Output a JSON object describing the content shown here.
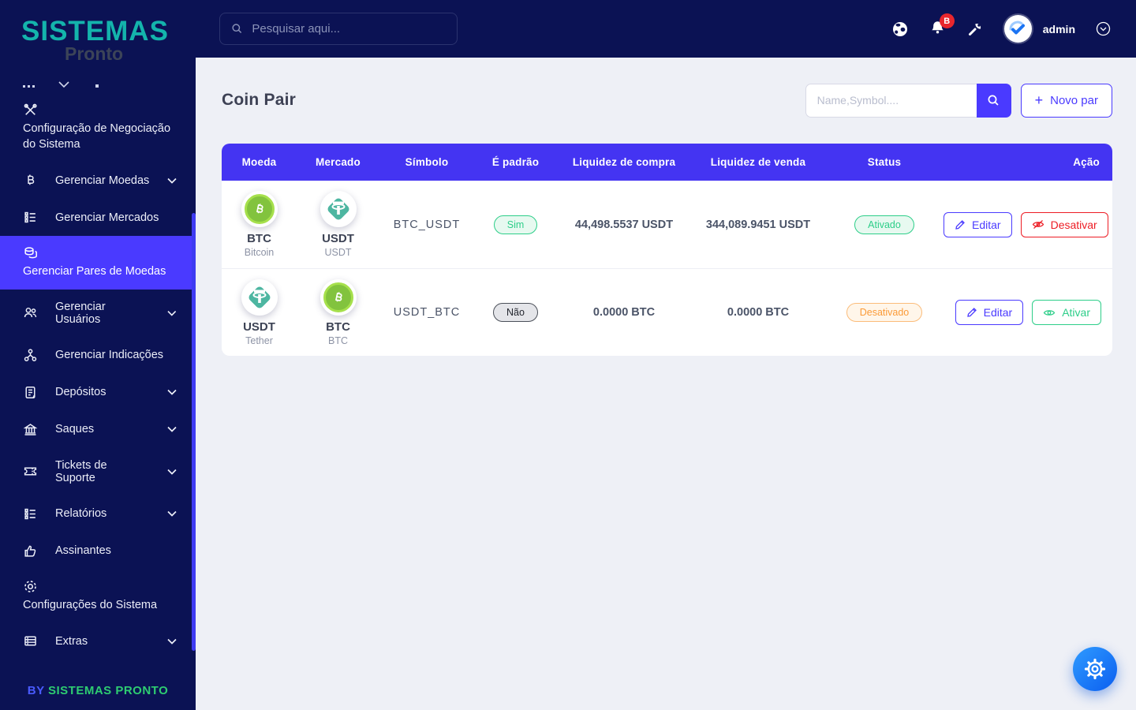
{
  "sidebar": {
    "logo_title": "SISTEMAS",
    "logo_subtitle": "Pronto",
    "items": [
      {
        "label": "Configuração de Negociação do Sistema",
        "icon": "tools-icon",
        "chevron": false
      },
      {
        "label": "Gerenciar Moedas",
        "icon": "bitcoin-icon",
        "chevron": true
      },
      {
        "label": "Gerenciar Mercados",
        "icon": "list-icon",
        "chevron": false
      },
      {
        "label": "Gerenciar Pares de Moedas",
        "icon": "coin-stack-icon",
        "chevron": false,
        "active": true
      },
      {
        "label": "Gerenciar Usuários",
        "icon": "users-icon",
        "chevron": true
      },
      {
        "label": "Gerenciar Indicações",
        "icon": "network-icon",
        "chevron": false
      },
      {
        "label": "Depósitos",
        "icon": "deposit-icon",
        "chevron": true
      },
      {
        "label": "Saques",
        "icon": "bank-icon",
        "chevron": true
      },
      {
        "label": "Tickets de Suporte",
        "icon": "ticket-icon",
        "chevron": true
      },
      {
        "label": "Relatórios",
        "icon": "report-icon",
        "chevron": true
      },
      {
        "label": "Assinantes",
        "icon": "thumbs-up-icon",
        "chevron": false
      },
      {
        "label": "Configurações do Sistema",
        "icon": "gear-icon",
        "chevron": false
      },
      {
        "label": "Extras",
        "icon": "extras-icon",
        "chevron": true
      }
    ],
    "footer_by": "BY",
    "footer_brand": "SISTEMAS PRONTO"
  },
  "topbar": {
    "search_placeholder": "Pesquisar aqui...",
    "notification_badge": "B",
    "username": "admin"
  },
  "page": {
    "title": "Coin Pair",
    "filter_placeholder": "Name,Symbol....",
    "new_pair_label": "Novo par"
  },
  "table": {
    "headers": [
      "Moeda",
      "Mercado",
      "Símbolo",
      "É padrão",
      "Liquidez de compra",
      "Liquidez de venda",
      "Status",
      "Ação"
    ],
    "rows": [
      {
        "coin": {
          "symbol": "BTC",
          "name": "Bitcoin",
          "icon": "bitcoin-coin-icon"
        },
        "market": {
          "symbol": "USDT",
          "name": "USDT",
          "icon": "tether-coin-icon"
        },
        "pair": "BTC_USDT",
        "is_default": "Sim",
        "buy_liquidity": "44,498.5537 USDT",
        "sell_liquidity": "344,089.9451 USDT",
        "status": "Ativado",
        "actions": [
          {
            "label": "Editar",
            "icon": "pencil-icon"
          },
          {
            "label": "Desativar",
            "icon": "eye-off-icon"
          }
        ]
      },
      {
        "coin": {
          "symbol": "USDT",
          "name": "Tether",
          "icon": "tether-coin-icon"
        },
        "market": {
          "symbol": "BTC",
          "name": "BTC",
          "icon": "bitcoin-coin-icon"
        },
        "pair": "USDT_BTC",
        "is_default": "Não",
        "buy_liquidity": "0.0000 BTC",
        "sell_liquidity": "0.0000 BTC",
        "status": "Desativado",
        "actions": [
          {
            "label": "Editar",
            "icon": "pencil-icon"
          },
          {
            "label": "Ativar",
            "icon": "eye-icon"
          }
        ]
      }
    ]
  },
  "colors": {
    "accent_purple": "#4a3aff",
    "table_header_purple": "#4434f2",
    "sidebar_navy": "#0b1254",
    "success_green": "#2dce89",
    "danger_red": "#ed1c24",
    "warning_orange": "#fb9b38",
    "logo_teal": "#14b4ac",
    "badge_red": "#e8262d"
  }
}
